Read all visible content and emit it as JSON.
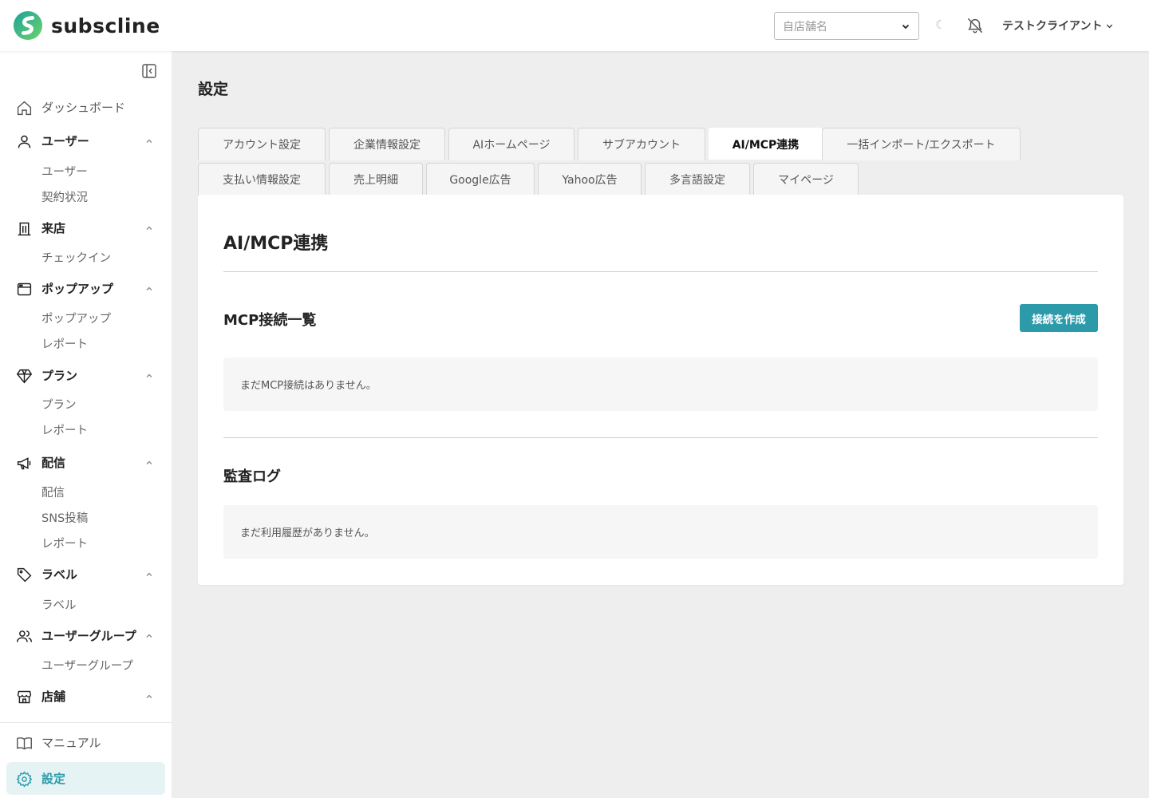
{
  "header": {
    "logo_text": "subscline",
    "store_placeholder": "自店舗名",
    "user_name": "テストクライアント"
  },
  "sidebar": {
    "dashboard": "ダッシュボード",
    "groups": [
      {
        "label": "ユーザー",
        "items": [
          "ユーザー",
          "契約状況"
        ]
      },
      {
        "label": "来店",
        "items": [
          "チェックイン"
        ]
      },
      {
        "label": "ポップアップ",
        "items": [
          "ポップアップ",
          "レポート"
        ]
      },
      {
        "label": "プラン",
        "items": [
          "プラン",
          "レポート"
        ]
      },
      {
        "label": "配信",
        "items": [
          "配信",
          "SNS投稿",
          "レポート"
        ]
      },
      {
        "label": "ラベル",
        "items": [
          "ラベル"
        ]
      },
      {
        "label": "ユーザーグループ",
        "items": [
          "ユーザーグループ"
        ]
      },
      {
        "label": "店舗",
        "items": []
      }
    ],
    "manual": "マニュアル",
    "settings": "設定"
  },
  "main": {
    "page_title": "設定",
    "tabs_row1": [
      "アカウント設定",
      "企業情報設定",
      "AIホームページ",
      "サブアカウント",
      "AI/MCP連携",
      "一括インポート/エクスポート"
    ],
    "tabs_row2": [
      "支払い情報設定",
      "売上明細",
      "Google広告",
      "Yahoo広告",
      "多言語設定",
      "マイページ"
    ],
    "active_tab": "AI/MCP連携",
    "card_title": "AI/MCP連携",
    "mcp_section_title": "MCP接続一覧",
    "create_button": "接続を作成",
    "mcp_empty": "まだMCP接続はありません。",
    "audit_section_title": "監査ログ",
    "audit_empty": "まだ利用履歴がありません。"
  },
  "colors": {
    "accent": "#2d9aaa",
    "active_bg": "#e6f3f5"
  }
}
